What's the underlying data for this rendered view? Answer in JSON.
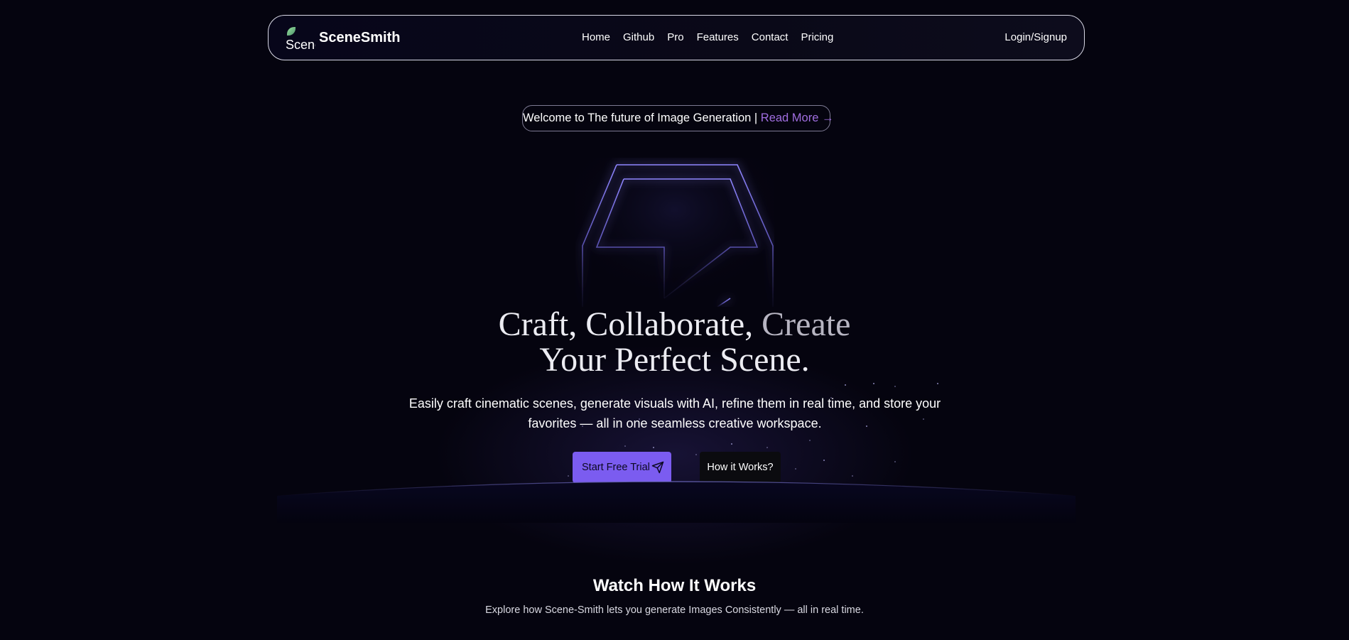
{
  "navbar": {
    "logo_alt": "Scene",
    "brand": "SceneSmith",
    "links": [
      "Home",
      "Github",
      "Pro",
      "Features",
      "Contact",
      "Pricing"
    ],
    "login": "Login/Signup"
  },
  "badge": {
    "text": "Welcome to The future of Image Generation | ",
    "link": "Read More →"
  },
  "hero": {
    "title_line1_a": "Craft, Collaborate, ",
    "title_line1_b": "Create",
    "title_line2": "Your Perfect Scene.",
    "subtitle": "Easily craft cinematic scenes, generate visuals with AI, refine them in real time, and store your favorites — all in one seamless creative workspace.",
    "primary_button": "Start Free Trial",
    "secondary_button": "How it Works?"
  },
  "section": {
    "title": "Watch How It Works",
    "subtitle": "Explore how Scene-Smith lets you generate Images Consistently — all in real time."
  },
  "colors": {
    "background": "#05040f",
    "accent": "#7b5cf0",
    "link": "#a06ee0",
    "glow": "#7a6fe0"
  },
  "icons": {
    "send": "send-icon"
  }
}
